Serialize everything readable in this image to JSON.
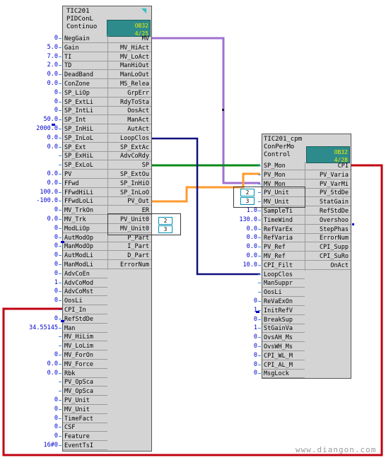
{
  "block1": {
    "title1": "TIC201",
    "title2": "PIDConL",
    "title3": "Continuo",
    "tag_top": "OB32",
    "tag_bottom": "4/25",
    "inputs": [
      {
        "label": "NegGain",
        "value": "0"
      },
      {
        "label": "Gain",
        "value": "5.0"
      },
      {
        "label": "TI",
        "value": "7.0"
      },
      {
        "label": "TD",
        "value": "2.0"
      },
      {
        "label": "DeadBand",
        "value": "0.0"
      },
      {
        "label": "ConZone",
        "value": "0.0"
      },
      {
        "label": "SP_LiOp",
        "value": "0"
      },
      {
        "label": "SP_ExtLi",
        "value": "0"
      },
      {
        "label": "SP_IntLi",
        "value": "0"
      },
      {
        "label": "SP_Int",
        "value": "50.0"
      },
      {
        "label": "SP_InHiL",
        "value": "2000.0"
      },
      {
        "label": "SP_InLoL",
        "value": "0.0"
      },
      {
        "label": "SP_Ext",
        "value": "0.0"
      },
      {
        "label": "SP_ExHiL",
        "value": ""
      },
      {
        "label": "SP_ExLoL",
        "value": ""
      },
      {
        "label": "PV",
        "value": "0.0"
      },
      {
        "label": "FFwd",
        "value": "0.0"
      },
      {
        "label": "FFwdHiLi",
        "value": "100.0"
      },
      {
        "label": "FFwdLoLi",
        "value": "-100.0"
      },
      {
        "label": "MV_TrkOn",
        "value": "0"
      },
      {
        "label": "MV_Trk",
        "value": "0.0"
      },
      {
        "label": "ModLiOp",
        "value": "0"
      },
      {
        "label": "AutModOp",
        "value": "0"
      },
      {
        "label": "ManModOp",
        "value": "0"
      },
      {
        "label": "AutModLi",
        "value": "0"
      },
      {
        "label": "ManModLi",
        "value": "0"
      },
      {
        "label": "AdvCoEn",
        "value": "0"
      },
      {
        "label": "AdvCoMod",
        "value": "1"
      },
      {
        "label": "AdvCoMst",
        "value": "0"
      },
      {
        "label": "OosLi",
        "value": "0"
      },
      {
        "label": "CPI_In",
        "value": ""
      },
      {
        "label": "RefStdDe",
        "value": "0"
      },
      {
        "label": "Man",
        "value": "34.55145"
      },
      {
        "label": "MV_HiLim",
        "value": ""
      },
      {
        "label": "MV_LoLim",
        "value": ""
      },
      {
        "label": "MV_ForOn",
        "value": "0"
      },
      {
        "label": "MV_Force",
        "value": "0.0"
      },
      {
        "label": "Rbk",
        "value": "0.0"
      },
      {
        "label": "PV_OpSca",
        "value": ""
      },
      {
        "label": "MV_OpSca",
        "value": ""
      },
      {
        "label": "PV_Unit",
        "value": "0"
      },
      {
        "label": "MV_Unit",
        "value": "0"
      },
      {
        "label": "TimeFact",
        "value": "0"
      },
      {
        "label": "CSF",
        "value": "0"
      },
      {
        "label": "Feature",
        "value": "0"
      },
      {
        "label": "EventTsI",
        "value": "16#0"
      }
    ],
    "outputs": [
      "MV",
      "MV_HiAct",
      "MV_LoAct",
      "ManHiOut",
      "ManLoOut",
      "MS_Relea",
      "GrpErr",
      "RdyToSta",
      "OosAct",
      "ManAct",
      "AutAct",
      "LoopClos",
      "SP_ExtAc",
      "AdvCoRdy",
      "SP",
      "SP_ExtOu",
      "SP_InHiO",
      "SP_InLoO",
      "PV_Out",
      "ER",
      "PV_Unit0",
      "MV_Unit0",
      "P_Part",
      "I_Part",
      "D_Part",
      "ErrorNum"
    ],
    "unit_chips": [
      "2",
      "3"
    ]
  },
  "block2": {
    "title1": "TIC201_cpm",
    "title2": "ConPerMo",
    "title3": "Control",
    "tag_top": "OB32",
    "tag_bottom": "4/28",
    "inputs": [
      {
        "label": "SP_Mon",
        "value": ""
      },
      {
        "label": "PV_Mon",
        "value": ""
      },
      {
        "label": "MV_Mon",
        "value": ""
      },
      {
        "label": "PV_Unit",
        "value": ""
      },
      {
        "label": "MV_Unit",
        "value": ""
      },
      {
        "label": "SampleTi",
        "value": "1.0"
      },
      {
        "label": "TimeWind",
        "value": "130.0"
      },
      {
        "label": "RefVarEx",
        "value": "0.0"
      },
      {
        "label": "RefVaria",
        "value": "0.0"
      },
      {
        "label": "PV_Ref",
        "value": "0.0"
      },
      {
        "label": "MV_Ref",
        "value": "0.0"
      },
      {
        "label": "CPI_Filt",
        "value": "10.0"
      },
      {
        "label": "LoopClos",
        "value": ""
      },
      {
        "label": "ManSuppr",
        "value": ""
      },
      {
        "label": "OosLi",
        "value": ""
      },
      {
        "label": "ReVaExOn",
        "value": "0"
      },
      {
        "label": "InitRefV",
        "value": "1"
      },
      {
        "label": "BreakSup",
        "value": "0"
      },
      {
        "label": "StGainVa",
        "value": "1"
      },
      {
        "label": "OvsAH_Ms",
        "value": "0"
      },
      {
        "label": "OvsWH_Ms",
        "value": "0"
      },
      {
        "label": "CPI_WL_M",
        "value": "0"
      },
      {
        "label": "CPI_AL_M",
        "value": "0"
      },
      {
        "label": "MsgLock",
        "value": "0"
      }
    ],
    "outputs": [
      "CPI",
      "PV_Varia",
      "PV_VarMi",
      "PV_StdDe",
      "StatGain",
      "RefStdDe",
      "Overshoo",
      "StepPhas",
      "ErrorNum",
      "CPI_Supp",
      "CPI_SuRo",
      "OnAct"
    ],
    "unit_chips": [
      "2",
      "3"
    ]
  },
  "watermark": "www.diangon.com",
  "wire_colors": {
    "mv": "#a070d0",
    "sp": "#0a8a1a",
    "pv": "#ff9a2e",
    "loopclos": "#101080",
    "cpi": "#c00010"
  }
}
